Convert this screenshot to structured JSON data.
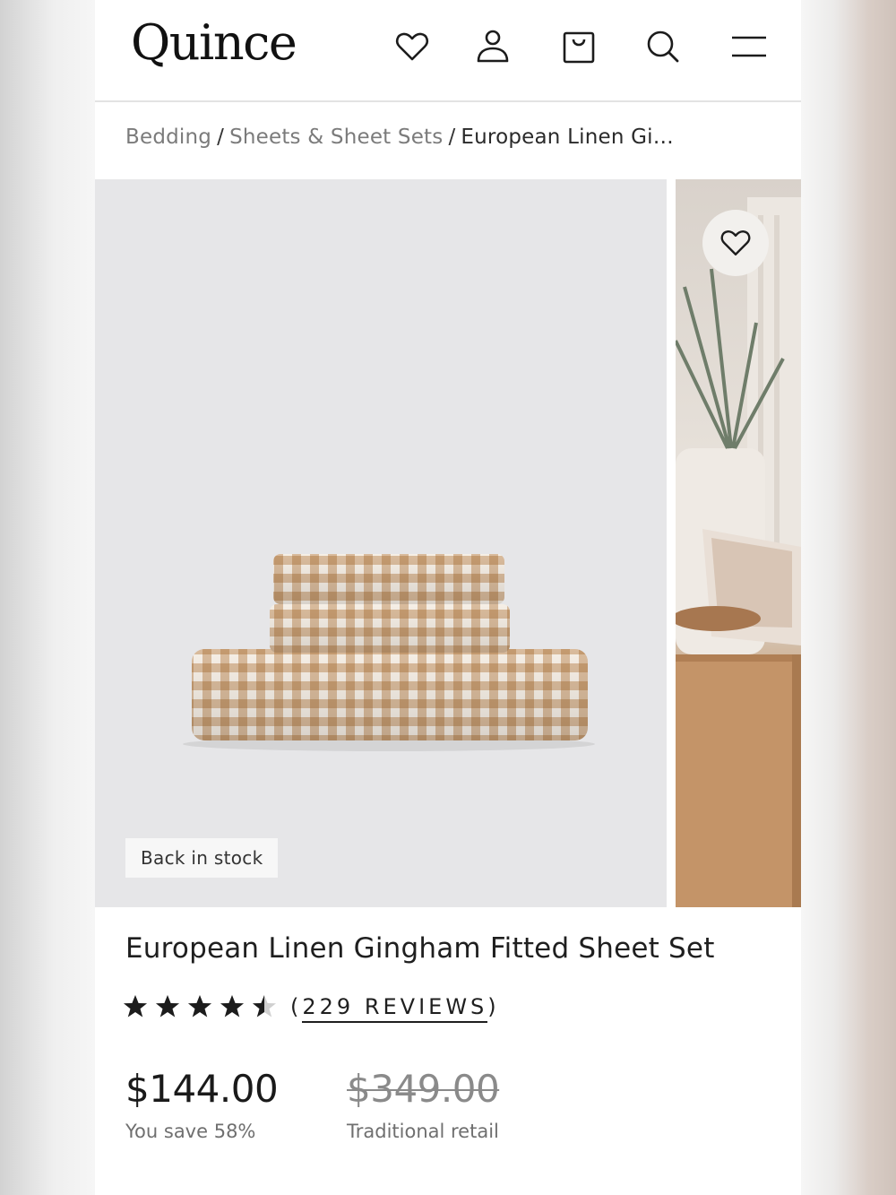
{
  "header": {
    "logo": "Quince",
    "icons": [
      "heart-icon",
      "account-icon",
      "shopping-bag-icon",
      "search-icon",
      "menu-icon"
    ]
  },
  "breadcrumb": {
    "items": [
      "Bedding",
      "Sheets & Sheet Sets"
    ],
    "current": "European Linen Gi…",
    "separator": "/"
  },
  "gallery": {
    "badge": "Back in stock",
    "gingham_color": "#c9a47f"
  },
  "product": {
    "title": "European Linen Gingham Fitted Sheet Set",
    "rating": 4.5,
    "reviews_text": "229 REVIEWS",
    "price": "$144.00",
    "savings": "You save 58%",
    "original_price": "$349.00",
    "original_label": "Traditional retail"
  }
}
